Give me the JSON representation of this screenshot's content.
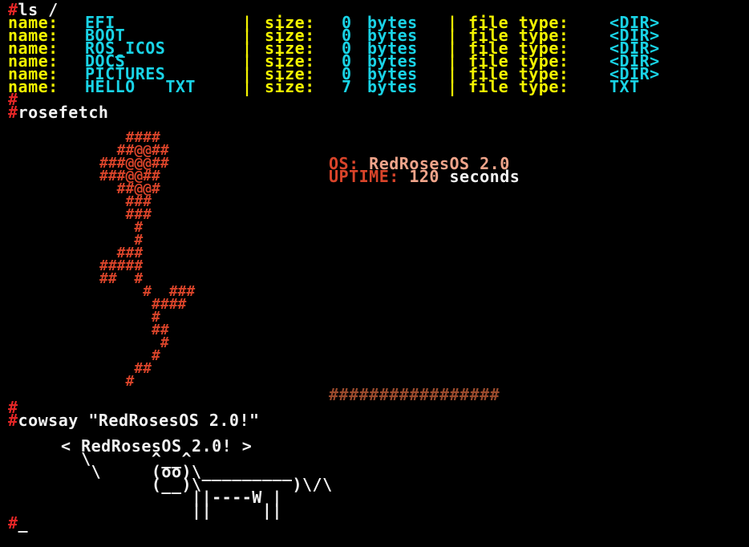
{
  "prompt_symbol": "#",
  "ls": {
    "command": "ls /",
    "name_label": "name:",
    "size_label": "size:",
    "type_label": "file type:",
    "bytes_label": "bytes",
    "separator": "|",
    "rows": [
      {
        "name": "EFI",
        "size": "0",
        "type": "<DIR>"
      },
      {
        "name": "BOOT",
        "size": "0",
        "type": "<DIR>"
      },
      {
        "name": "ROS_ICOS",
        "size": "0",
        "type": "<DIR>"
      },
      {
        "name": "DOCS",
        "size": "0",
        "type": "<DIR>"
      },
      {
        "name": "PICTURES",
        "size": "0",
        "type": "<DIR>"
      },
      {
        "name": "HELLO   TXT",
        "size": "7",
        "type": "TXT"
      }
    ]
  },
  "rosefetch": {
    "command": "rosefetch",
    "art": [
      "   ####",
      "  ##@@##",
      "###@@@##",
      "###@@##",
      "  ##@@#",
      "   ###",
      "   ###",
      "    #",
      "    #",
      "  ###",
      "#####",
      "##  #",
      "     #  ###",
      "      ####",
      "      #",
      "      ##",
      "       #",
      "      #",
      "    ##",
      "   #"
    ],
    "os_label": "OS:",
    "os_value": "RedRosesOS 2.0",
    "uptime_label": "UPTIME:",
    "uptime_value": "120",
    "uptime_unit": "seconds",
    "stripe": "#################"
  },
  "cowsay": {
    "command": "cowsay \"RedRosesOS 2.0!\"",
    "lines": [
      "< RedRosesOS 2.0! >",
      "  \\      ^__^",
      "   \\     (oo)\\_________",
      "         (__)\\         )\\/\\",
      "             ||----W |",
      "             ||     ||"
    ]
  },
  "cursor": "_",
  "colors": {
    "background": "#000000",
    "prompt": "#e32626",
    "label": "#f3f300",
    "value": "#19d3e6",
    "rose": "#d9442a",
    "info_label": "#d9442a",
    "info_value": "#f0a48a",
    "text": "#f2f2f2"
  }
}
